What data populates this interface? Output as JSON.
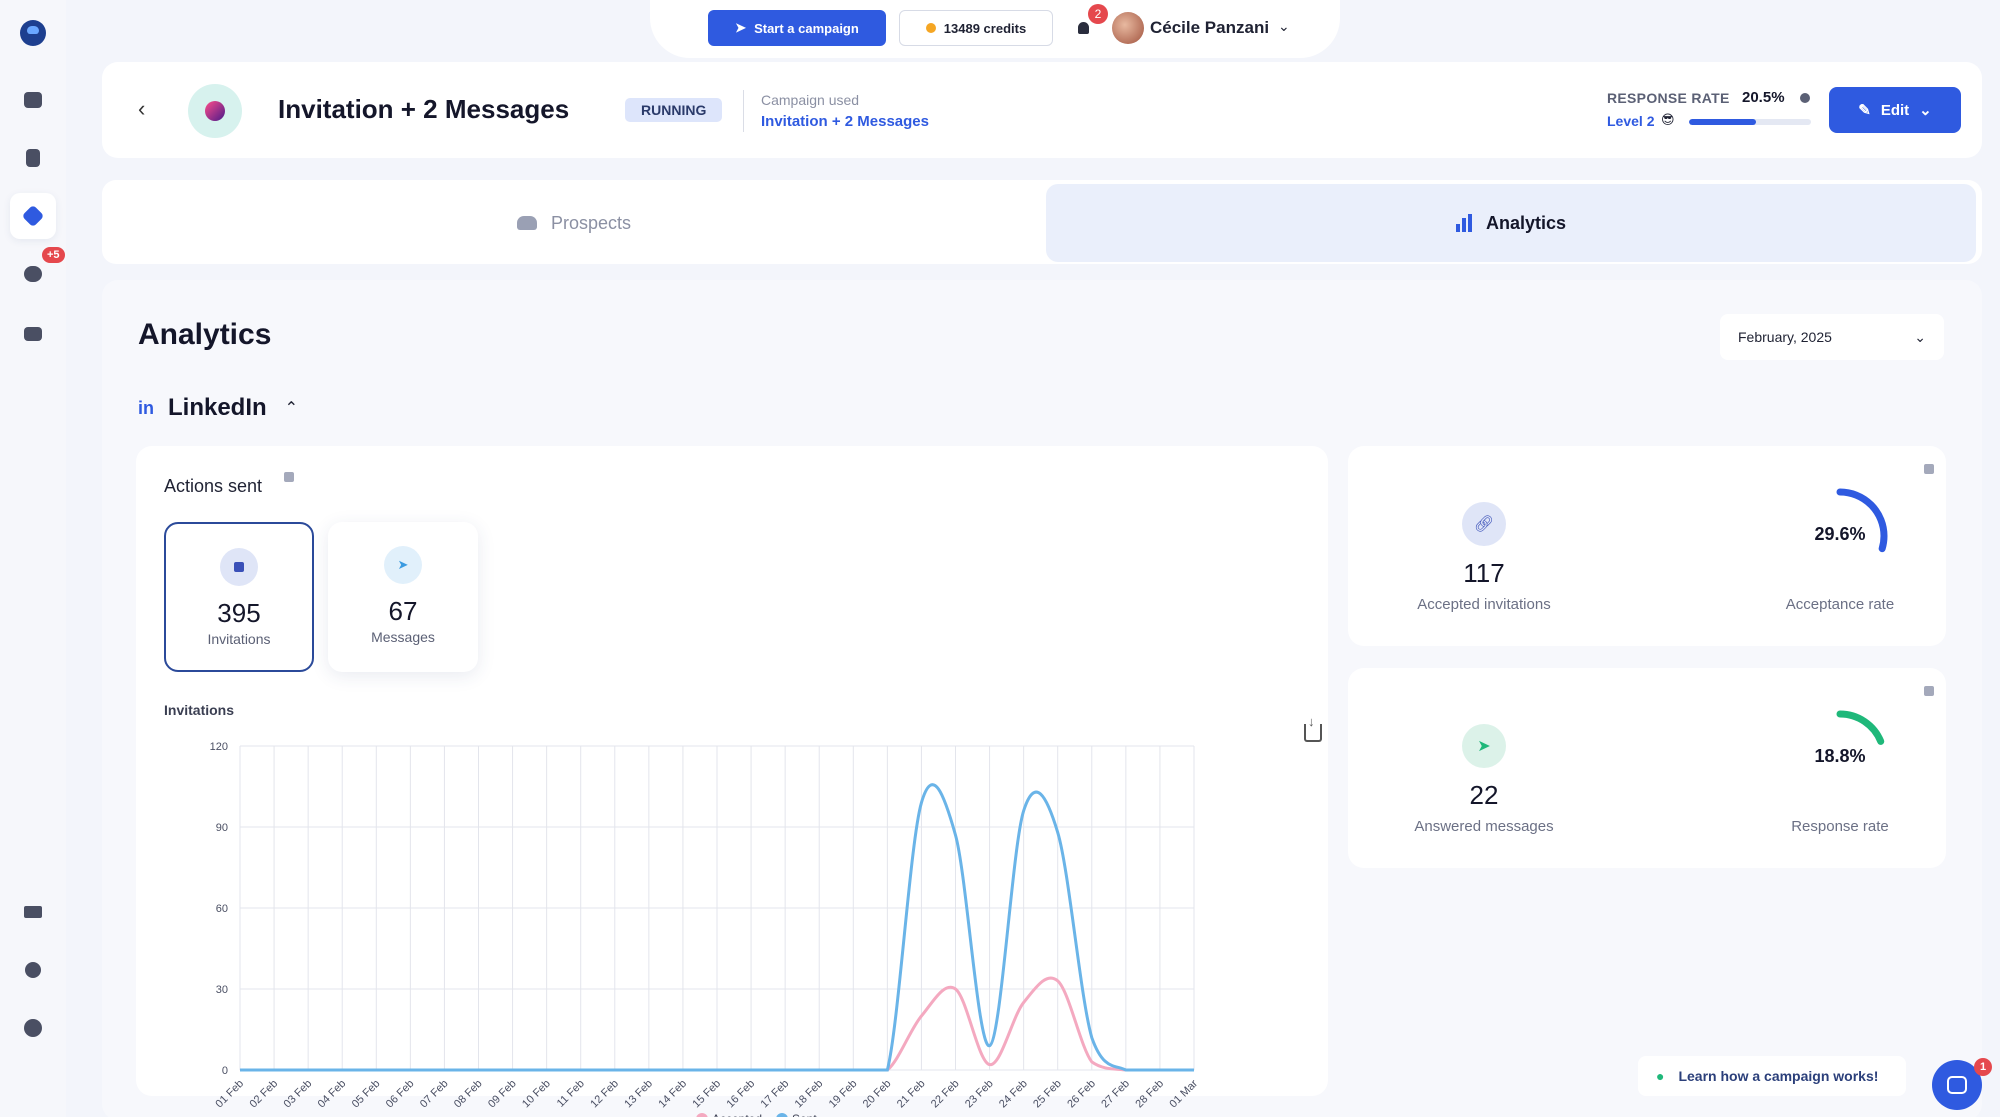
{
  "topbar": {
    "start_campaign": "Start a campaign",
    "credits": "13489 credits",
    "notification_count": "2",
    "user_name": "Cécile Panzani"
  },
  "sidebar": {
    "messages_badge": "+5"
  },
  "header": {
    "campaign_title": "Invitation + 2 Messages",
    "status": "RUNNING",
    "campaign_used_label": "Campaign used",
    "campaign_used_value": "Invitation + 2 Messages",
    "response_rate_label": "RESPONSE RATE",
    "response_rate_value": "20.5%",
    "level_label": "Level 2",
    "level_emoji": "😎",
    "level_progress": 0.55,
    "edit_label": "Edit"
  },
  "tabs": {
    "prospects": "Prospects",
    "analytics": "Analytics"
  },
  "analytics": {
    "page_title": "Analytics",
    "month": "February, 2025",
    "section_icon": "in",
    "section_title": "LinkedIn",
    "actions_title": "Actions sent",
    "invitations_count": "395",
    "invitations_label": "Invitations",
    "messages_count": "67",
    "messages_label": "Messages",
    "chart_title": "Invitations",
    "accepted_count": "117",
    "accepted_label": "Accepted invitations",
    "acceptance_rate": "29.6%",
    "acceptance_rate_value": 0.296,
    "acceptance_label": "Acceptance rate",
    "answered_count": "22",
    "answered_label": "Answered messages",
    "response_rate": "18.8%",
    "response_rate_value": 0.188,
    "response_label": "Response rate"
  },
  "footer": {
    "learn_label": "Learn how a campaign works!",
    "chat_badge": "1"
  },
  "colors": {
    "accent": "#2f5ae0",
    "sent": "#6ab4e8",
    "accepted": "#f4a9c0",
    "response_gauge": "#1fb87a"
  },
  "chart_data": {
    "type": "line",
    "title": "Invitations",
    "x": [
      "01 Feb",
      "02 Feb",
      "03 Feb",
      "04 Feb",
      "05 Feb",
      "06 Feb",
      "07 Feb",
      "08 Feb",
      "09 Feb",
      "10 Feb",
      "11 Feb",
      "12 Feb",
      "13 Feb",
      "14 Feb",
      "15 Feb",
      "16 Feb",
      "17 Feb",
      "18 Feb",
      "19 Feb",
      "20 Feb",
      "21 Feb",
      "22 Feb",
      "23 Feb",
      "24 Feb",
      "25 Feb",
      "26 Feb",
      "27 Feb",
      "28 Feb",
      "01 Mar"
    ],
    "ylim": [
      0,
      120
    ],
    "yticks": [
      0,
      30,
      60,
      90,
      120
    ],
    "grid": true,
    "legend_position": "bottom",
    "series": [
      {
        "name": "Accepted",
        "values": [
          0,
          0,
          0,
          0,
          0,
          0,
          0,
          0,
          0,
          0,
          0,
          0,
          0,
          0,
          0,
          0,
          0,
          0,
          0,
          0,
          20,
          30,
          2,
          25,
          33,
          3,
          0,
          0,
          0
        ]
      },
      {
        "name": "Sent",
        "values": [
          0,
          0,
          0,
          0,
          0,
          0,
          0,
          0,
          0,
          0,
          0,
          0,
          0,
          0,
          0,
          0,
          0,
          0,
          0,
          0,
          99,
          87,
          9,
          96,
          88,
          12,
          0,
          0,
          0
        ]
      }
    ]
  }
}
